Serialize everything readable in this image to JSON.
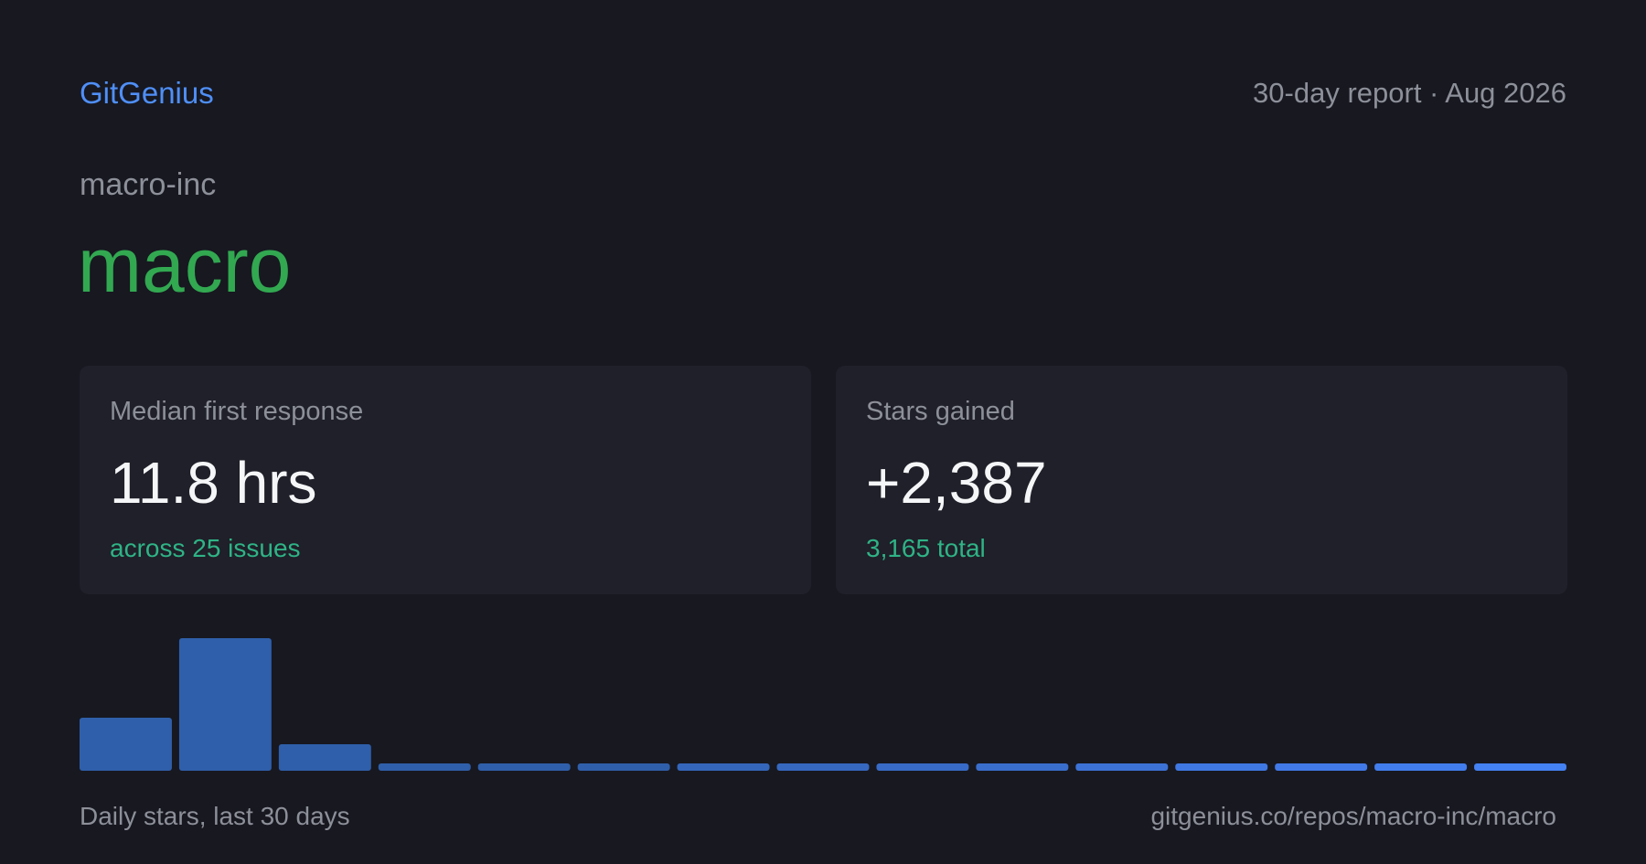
{
  "header": {
    "brand": "GitGenius",
    "report_label": "30-day report · Aug 2026"
  },
  "repo": {
    "owner": "macro-inc",
    "name": "macro"
  },
  "cards": [
    {
      "label": "Median first response",
      "value": "11.8 hrs",
      "sub": "across 25 issues"
    },
    {
      "label": "Stars gained",
      "value": "+2,387",
      "sub": "3,165 total"
    }
  ],
  "chart_data": {
    "type": "bar",
    "values": [
      58,
      145,
      29,
      8,
      8,
      8,
      8,
      8,
      8,
      8,
      8,
      8,
      8,
      8,
      8
    ],
    "colors": [
      "#2f5faa",
      "#2f5faa",
      "#2f5faa",
      "#2f5faa",
      "#2f5faa",
      "#2f5faa",
      "#3466bb",
      "#3668c0",
      "#386bc7",
      "#3a6ecd",
      "#3c72d6",
      "#3f78e2",
      "#4179e8",
      "#427ded",
      "#4481f2"
    ],
    "caption": "Daily stars, last 30 days",
    "grid": false
  },
  "footer": {
    "url": "gitgenius.co/repos/macro-inc/macro"
  },
  "colors": {
    "background": "#171820",
    "card": "#1f2029",
    "brand": "#4f8ff7",
    "repo_name": "#32a851",
    "accent_text": "#2fb386",
    "muted_text": "#8d8f99"
  }
}
